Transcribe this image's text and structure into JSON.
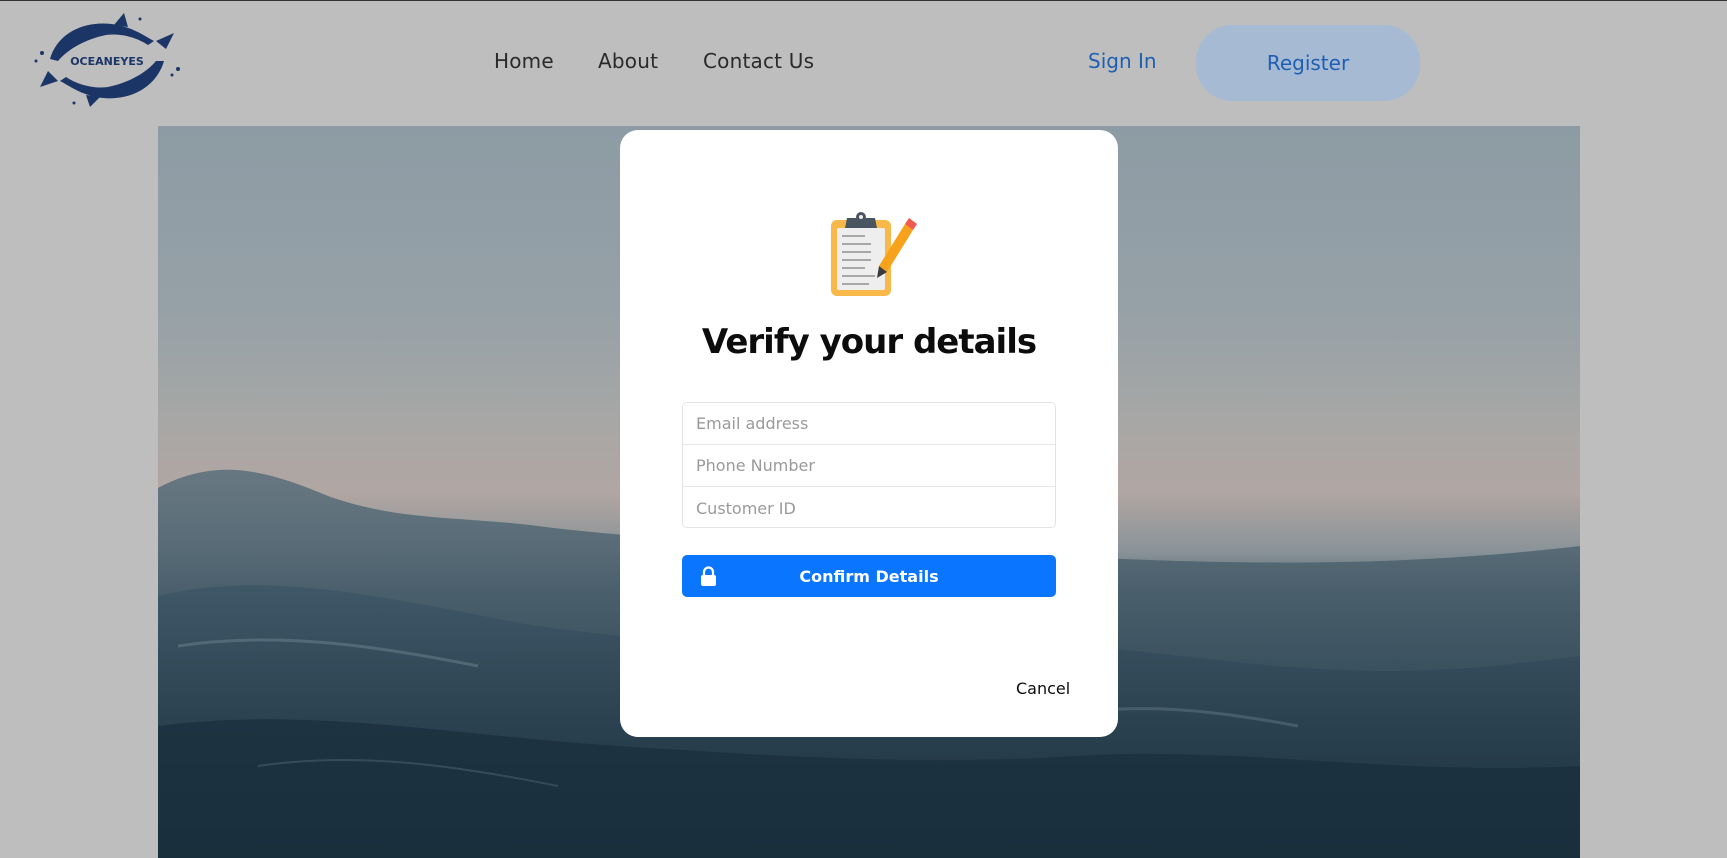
{
  "header": {
    "logo_text": "OCEANEYES",
    "nav": [
      "Home",
      "About",
      "Contact Us"
    ],
    "sign_in": "Sign In",
    "register": "Register"
  },
  "modal": {
    "icon": "clipboard-pencil-icon",
    "title": "Verify your details",
    "fields": {
      "email_placeholder": "Email address",
      "phone_placeholder": "Phone Number",
      "customer_id_placeholder": "Customer ID"
    },
    "confirm_label": "Confirm Details",
    "confirm_icon": "lock-icon",
    "cancel_label": "Cancel"
  },
  "colors": {
    "background": "#bebebe",
    "accent": "#0a76ff",
    "link": "#1e5fb3",
    "register_bg": "#a7bad3",
    "logo": "#1b3566"
  }
}
